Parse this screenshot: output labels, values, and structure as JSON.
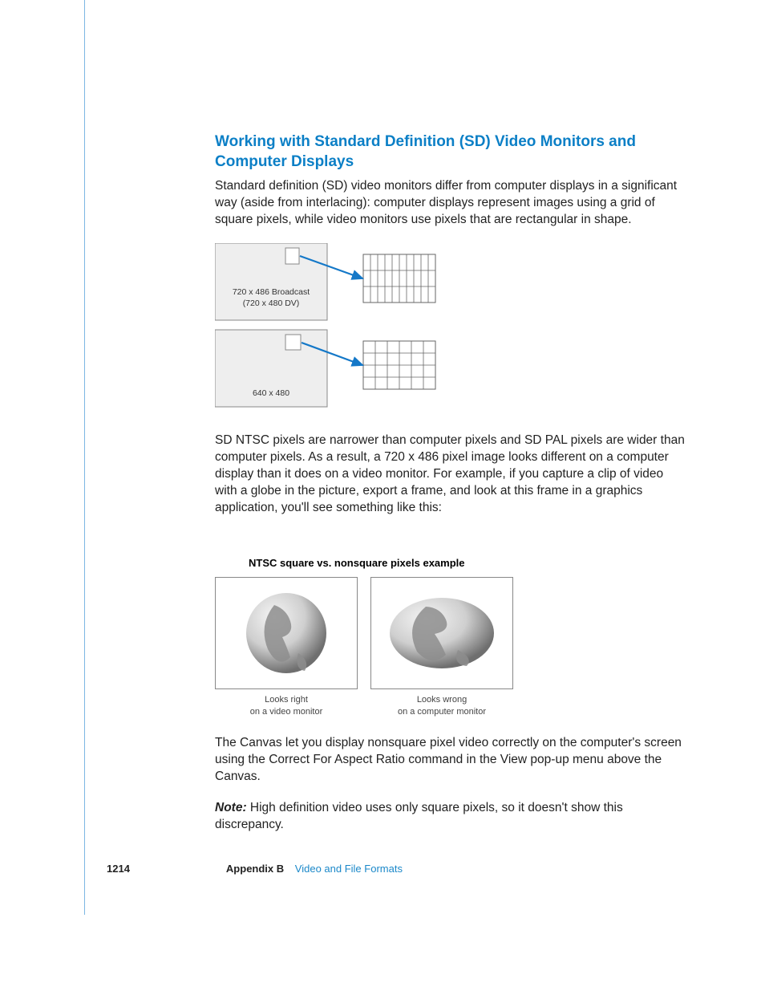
{
  "heading": "Working with Standard Definition (SD) Video Monitors and Computer Displays",
  "para1": "Standard definition (SD) video monitors differ from computer displays in a significant way (aside from interlacing):  computer displays represent images using a grid of square pixels, while video monitors use pixels that are rectangular in shape.",
  "fig1": {
    "box1_line1": "720 x 486 Broadcast",
    "box1_line2": "(720 x 480 DV)",
    "box2_line1": "640 x 480"
  },
  "para2": "SD NTSC pixels are narrower than computer pixels and SD PAL pixels are wider than computer pixels. As a result, a 720 x 486 pixel image looks different on a computer display than it does on a video monitor. For example, if you capture a clip of video with a globe in the picture, export a frame, and look at this frame in a graphics application, you'll see something like this:",
  "fig2": {
    "title": "NTSC square vs. nonsquare pixels example",
    "left_line1": "Looks right",
    "left_line2": "on a video monitor",
    "right_line1": "Looks wrong",
    "right_line2": "on a computer monitor"
  },
  "para3": "The Canvas let you display nonsquare pixel video correctly on the computer's screen using the Correct For Aspect Ratio command in the View pop-up menu above the Canvas.",
  "para4_prefix": "Note:",
  "para4": "  High definition video uses only square pixels, so it doesn't show this discrepancy.",
  "footer": {
    "page": "1214",
    "appendix": "Appendix B",
    "title": "Video and File Formats"
  }
}
